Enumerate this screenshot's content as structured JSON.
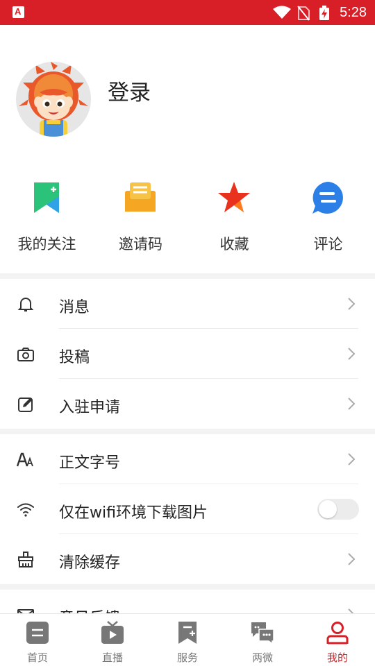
{
  "status_bar": {
    "time": "5:28",
    "app_icon_letter": "A"
  },
  "profile": {
    "login_label": "登录"
  },
  "quick_actions": [
    {
      "label": "我的关注",
      "icon": "bookmark-plus-icon",
      "color": "#2bc37a"
    },
    {
      "label": "邀请码",
      "icon": "envelope-icon",
      "color": "#f5a623"
    },
    {
      "label": "收藏",
      "icon": "star-icon",
      "color": "#e8321d"
    },
    {
      "label": "评论",
      "icon": "comment-bubble-icon",
      "color": "#2d7fe8"
    }
  ],
  "menu_group_1": [
    {
      "label": "消息",
      "icon": "bell-icon"
    },
    {
      "label": "投稿",
      "icon": "camera-icon"
    },
    {
      "label": "入驻申请",
      "icon": "edit-icon"
    }
  ],
  "menu_group_2": [
    {
      "label": "正文字号",
      "icon": "font-size-icon"
    },
    {
      "label": "仅在wifi环境下载图片",
      "icon": "wifi-icon",
      "toggle_on": false
    },
    {
      "label": "清除缓存",
      "icon": "brush-icon"
    }
  ],
  "menu_group_3": [
    {
      "label": "意见反馈",
      "icon": "mail-icon"
    }
  ],
  "tab_bar": [
    {
      "label": "首页",
      "icon": "home-news-icon",
      "active": false
    },
    {
      "label": "直播",
      "icon": "tv-play-icon",
      "active": false
    },
    {
      "label": "服务",
      "icon": "service-bookmark-icon",
      "active": false
    },
    {
      "label": "两微",
      "icon": "chat-bubbles-icon",
      "active": false
    },
    {
      "label": "我的",
      "icon": "user-icon",
      "active": true
    }
  ],
  "colors": {
    "brand_red": "#d81e26",
    "tab_inactive": "#777777",
    "section_gap": "#f3f3f3"
  }
}
